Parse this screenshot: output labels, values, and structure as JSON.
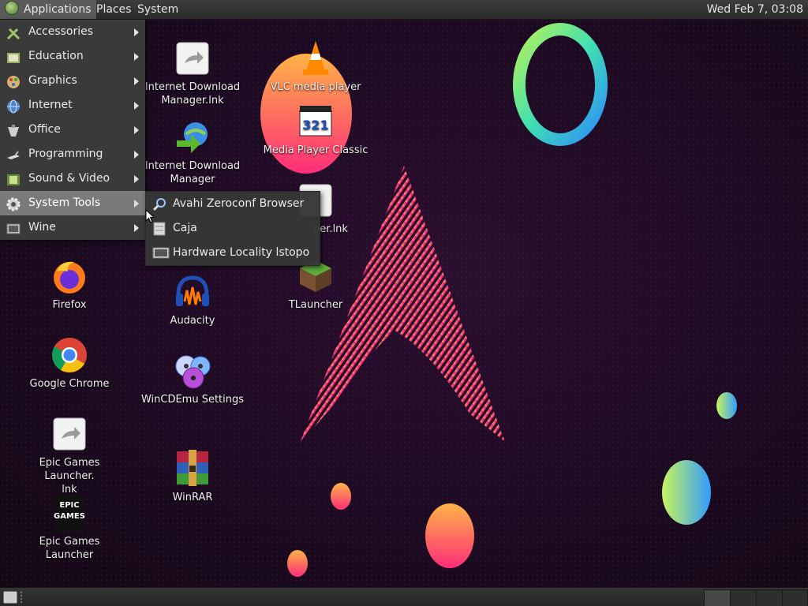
{
  "top_panel": {
    "menus": [
      "Applications",
      "Places",
      "System"
    ],
    "clock": "Wed Feb  7, 03:08"
  },
  "app_menu": {
    "items": [
      {
        "label": "Accessories",
        "icon": "accessories-icon"
      },
      {
        "label": "Education",
        "icon": "education-icon"
      },
      {
        "label": "Graphics",
        "icon": "graphics-icon"
      },
      {
        "label": "Internet",
        "icon": "internet-icon"
      },
      {
        "label": "Office",
        "icon": "office-icon"
      },
      {
        "label": "Programming",
        "icon": "programming-icon"
      },
      {
        "label": "Sound & Video",
        "icon": "sound-video-icon"
      },
      {
        "label": "System Tools",
        "icon": "gear-icon"
      },
      {
        "label": "Wine",
        "icon": "wine-icon"
      }
    ],
    "active": "System Tools"
  },
  "system_tools_submenu": {
    "items": [
      {
        "label": "Avahi Zeroconf Browser",
        "icon": "network-browser-icon"
      },
      {
        "label": "Caja",
        "icon": "file-cabinet-icon"
      },
      {
        "label": "Hardware Locality lstopo",
        "icon": "monitor-icon"
      }
    ]
  },
  "desktop_icons": [
    {
      "label": "Internet Download Manager.lnk",
      "icon": "shortcut-icon"
    },
    {
      "label": "Internet Download Manager",
      "icon": "download-globe-icon"
    },
    {
      "label": "VLC media player",
      "icon": "vlc-cone-icon"
    },
    {
      "label": "Media Player Classic",
      "icon": "media-player-321-icon"
    },
    {
      "label": "her.lnk",
      "icon": "shortcut-icon"
    },
    {
      "label": "Firefox",
      "icon": "firefox-icon"
    },
    {
      "label": "Audacity",
      "icon": "audacity-icon"
    },
    {
      "label": "TLauncher",
      "icon": "grass-block-icon"
    },
    {
      "label": "Google Chrome",
      "icon": "chrome-icon"
    },
    {
      "label": "WinCDEmu Settings",
      "icon": "cd-discs-icon"
    },
    {
      "label": "Epic Games Launcher.\nlnk",
      "icon": "shortcut-icon"
    },
    {
      "label": "WinRAR",
      "icon": "winrar-books-icon"
    },
    {
      "label": "Epic Games Launcher",
      "icon": "epic-games-icon"
    }
  ],
  "epic_logo_text": "EPIC GAMES",
  "mpc_badge": "321",
  "colors": {
    "panel": "#2f2f2f",
    "menu_bg": "#3c3c3c",
    "menu_active": "#7a7a7a",
    "wallpaper": "#1d0a22",
    "accent_pink": "#ff2d78",
    "accent_orange": "#ffb347"
  }
}
